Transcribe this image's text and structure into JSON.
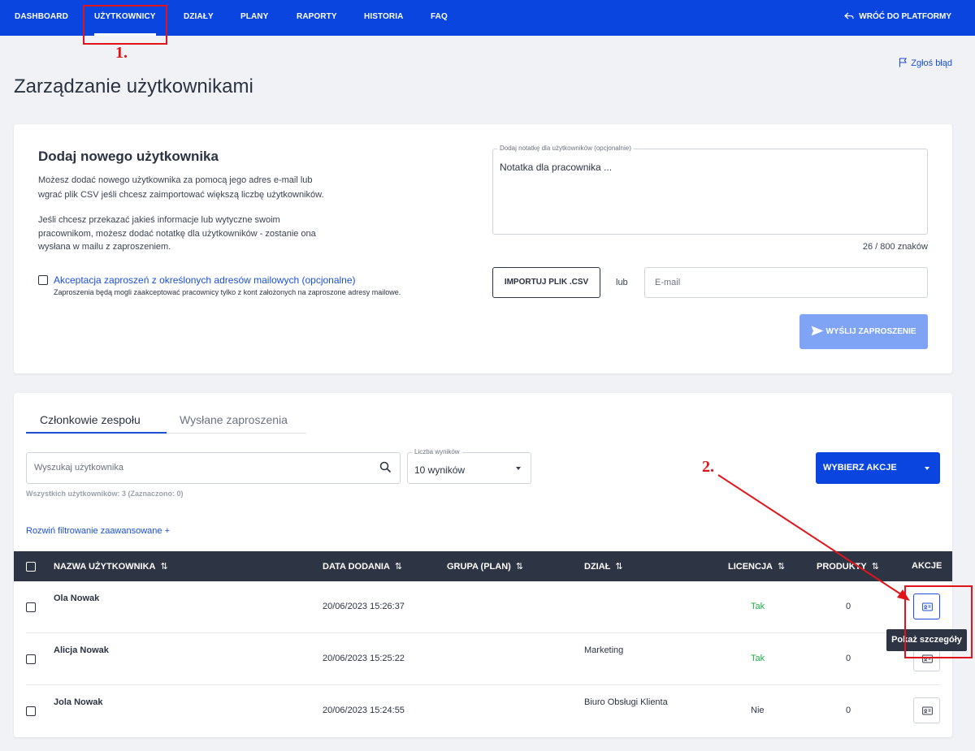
{
  "nav": {
    "items": [
      "DASHBOARD",
      "UŻYTKOWNICY",
      "DZIAŁY",
      "PLANY",
      "RAPORTY",
      "HISTORIA",
      "FAQ"
    ],
    "back_label": "WRÓĆ DO PLATFORMY"
  },
  "annotations": {
    "step1": "1.",
    "step2": "2."
  },
  "report_link": "Zgłoś błąd",
  "page_title": "Zarządzanie użytkownikami",
  "add_user": {
    "title": "Dodaj nowego użytkownika",
    "desc1_line1": "Możesz dodać nowego użytkownika za pomocą jego adres e-mail lub",
    "desc1_line2": "wgrać plik CSV jeśli chcesz zaimportować większą liczbę użytkowników.",
    "desc2_line1": "Jeśli chcesz przekazać jakieś informacje lub wytyczne swoim",
    "desc2_line2": "pracownikom, możesz dodać notatkę dla użytkowników - zostanie ona",
    "desc2_line3": "wysłana w mailu z zaproszeniem.",
    "accept_label": "Akceptacja zaproszeń z określonych adresów mailowych (opcjonalne)",
    "accept_note": "Zaproszenia będą mogli zaakceptować pracownicy tylko z kont założonych na zaproszone adresy mailowe.",
    "note_legend": "Dodaj notatkę dla użytkowników (opcjonalnie)",
    "note_value": "Notatka dla pracownika ...",
    "char_count": "26 / 800 znaków",
    "import_label": "IMPORTUJ PLIK .CSV",
    "or_label": "lub",
    "email_placeholder": "E-mail",
    "send_label": "WYŚLIJ ZAPROSZENIE"
  },
  "tabs": [
    "Członkowie zespołu",
    "Wysłane zaproszenia"
  ],
  "search": {
    "placeholder": "Wyszukaj użytkownika"
  },
  "results": {
    "legend": "Liczba wyników",
    "value": "10 wyników"
  },
  "action_button": "WYBIERZ AKCJE",
  "total_text": "Wszystkich użytkowników: 3 (Zaznaczono: 0)",
  "filter_link": "Rozwiń filtrowanie zaawansowane +",
  "table": {
    "headers": [
      "NAZWA UŻYTKOWNIKA",
      "DATA DODANIA",
      "GRUPA (PLAN)",
      "DZIAŁ",
      "LICENCJA",
      "PRODUKTY",
      "AKCJE"
    ],
    "sort_glyph": "⇅",
    "rows": [
      {
        "name": "Ola Nowak",
        "date": "20/06/2023 15:26:37",
        "group": "",
        "dept": "",
        "license": "Tak",
        "products": "0"
      },
      {
        "name": "Alicja Nowak",
        "date": "20/06/2023 15:25:22",
        "group": "",
        "dept": "Marketing",
        "license": "Tak",
        "products": "0"
      },
      {
        "name": "Jola Nowak",
        "date": "20/06/2023 15:24:55",
        "group": "",
        "dept": "Biuro Obsługi Klienta",
        "license": "Nie",
        "products": "0"
      }
    ]
  },
  "tooltip": "Pokaż szczegóły",
  "colors": {
    "brand": "#0a45e0",
    "link": "#1a4fd6",
    "yes": "#1dab4a",
    "annotation": "#e0151b",
    "table_header": "#2d3444"
  }
}
